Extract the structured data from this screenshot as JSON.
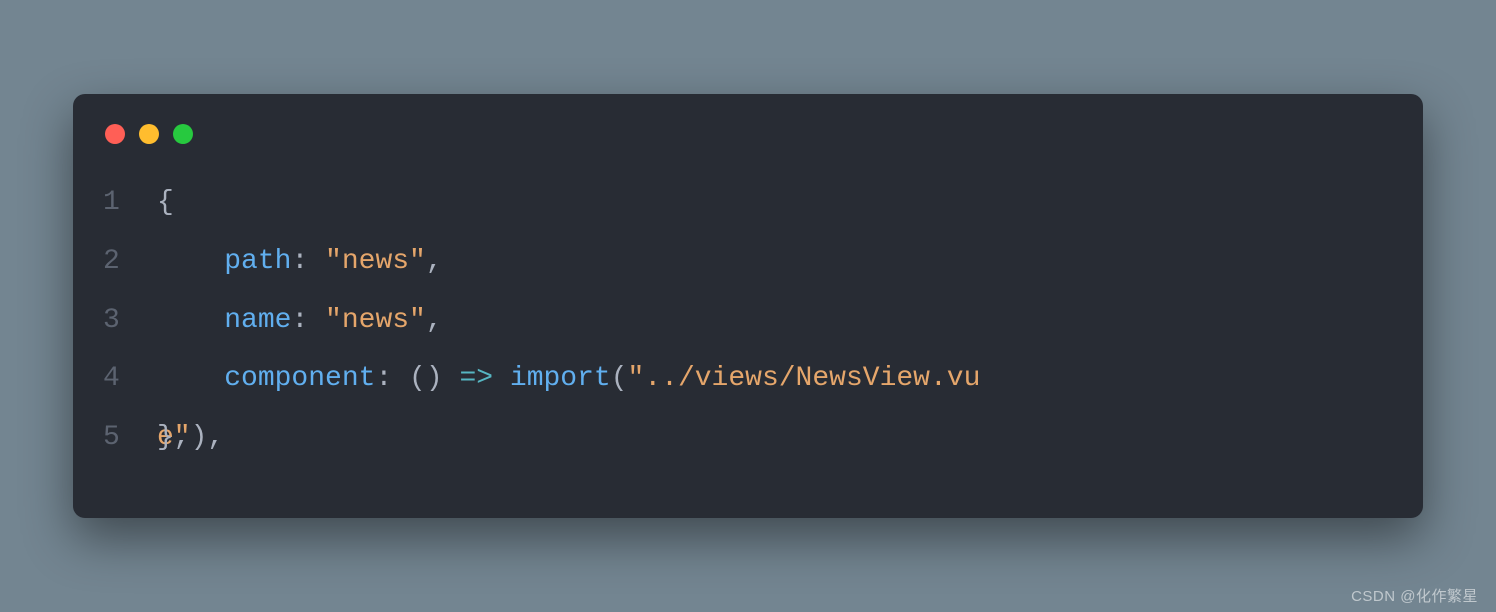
{
  "titlebar": {
    "dots": [
      "close",
      "minimize",
      "zoom"
    ]
  },
  "code": {
    "lines": [
      {
        "num": "1",
        "tokens": [
          {
            "cls": "c-brace",
            "t": "{"
          }
        ]
      },
      {
        "num": "2",
        "tokens": [
          {
            "cls": "c-punc",
            "t": "    "
          },
          {
            "cls": "c-key",
            "t": "path"
          },
          {
            "cls": "c-punc",
            "t": ": "
          },
          {
            "cls": "c-str",
            "t": "\"news\""
          },
          {
            "cls": "c-punc",
            "t": ","
          }
        ]
      },
      {
        "num": "3",
        "tokens": [
          {
            "cls": "c-punc",
            "t": "    "
          },
          {
            "cls": "c-key",
            "t": "name"
          },
          {
            "cls": "c-punc",
            "t": ": "
          },
          {
            "cls": "c-str",
            "t": "\"news\""
          },
          {
            "cls": "c-punc",
            "t": ","
          }
        ]
      },
      {
        "num": "4",
        "tokens": [
          {
            "cls": "c-punc",
            "t": "    "
          },
          {
            "cls": "c-key",
            "t": "component"
          },
          {
            "cls": "c-punc",
            "t": ": () "
          },
          {
            "cls": "c-op",
            "t": "=>"
          },
          {
            "cls": "c-punc",
            "t": " "
          },
          {
            "cls": "c-import",
            "t": "import"
          },
          {
            "cls": "c-punc",
            "t": "("
          },
          {
            "cls": "c-str",
            "t": "\"../views/NewsView.vu"
          }
        ]
      },
      {
        "num": "5",
        "tokens": [
          {
            "cls": "c-str",
            "t": "e\""
          },
          {
            "cls": "c-punc",
            "t": "),"
          }
        ]
      }
    ],
    "line5_overlay": "},"
  },
  "watermark": "CSDN @化作繁星"
}
